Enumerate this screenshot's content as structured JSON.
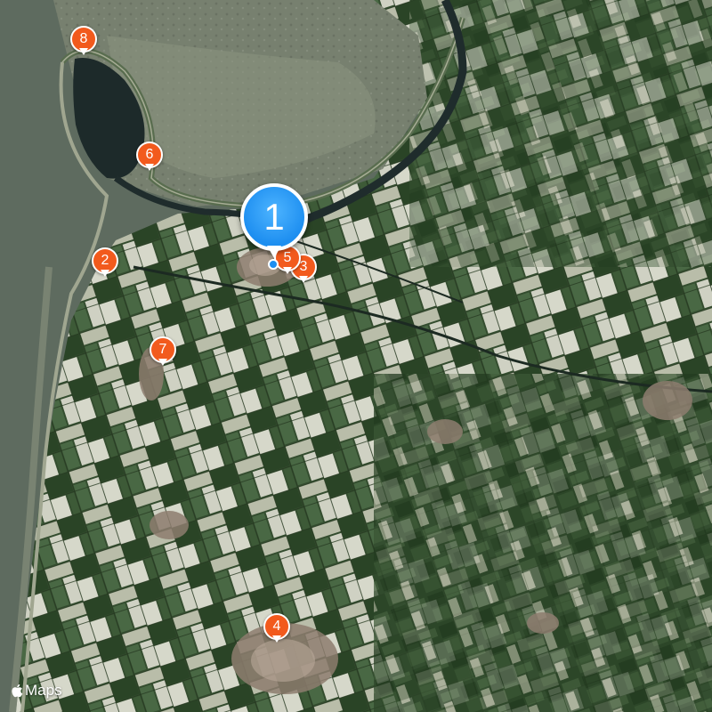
{
  "brand": {
    "label": "Maps",
    "icon": "apple-logo-icon"
  },
  "colors": {
    "sea": "#5d6a5e",
    "tidal_flat": "#7d8676",
    "field_dark": "#2f4a2b",
    "field_light": "#c9ccbc",
    "pin_orange": "#f25a1d",
    "pin_blue": "#1d8ef0"
  },
  "pins": [
    {
      "label": "1",
      "selected": true
    },
    {
      "label": "2"
    },
    {
      "label": "3"
    },
    {
      "label": "4"
    },
    {
      "label": "5"
    },
    {
      "label": "6"
    },
    {
      "label": "7"
    },
    {
      "label": "8"
    }
  ]
}
